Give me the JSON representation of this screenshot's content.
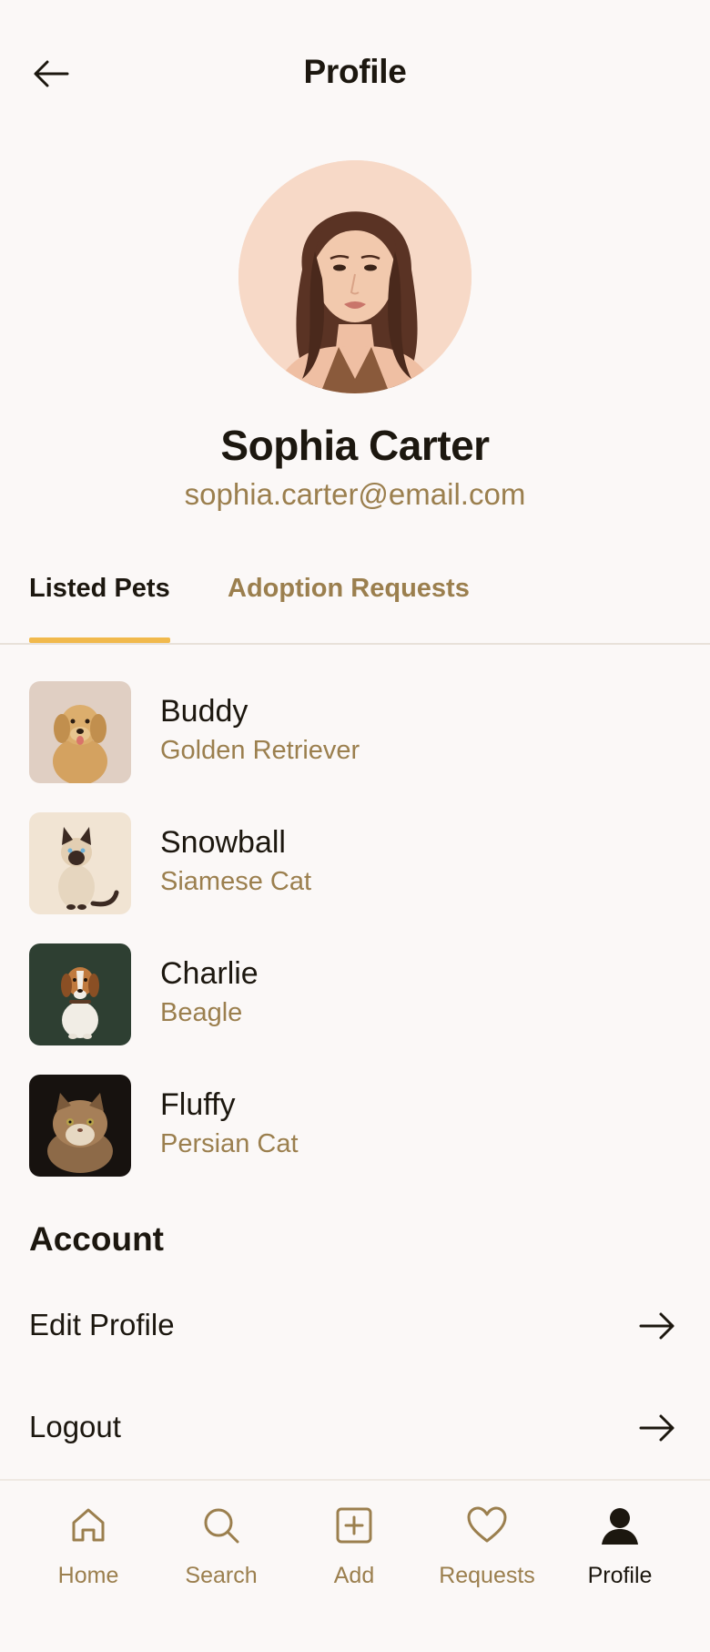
{
  "header": {
    "title": "Profile"
  },
  "user": {
    "name": "Sophia Carter",
    "email": "sophia.carter@email.com"
  },
  "tabs": [
    {
      "label": "Listed Pets",
      "active": true
    },
    {
      "label": "Adoption Requests",
      "active": false
    }
  ],
  "pets": [
    {
      "name": "Buddy",
      "breed": "Golden Retriever"
    },
    {
      "name": "Snowball",
      "breed": "Siamese Cat"
    },
    {
      "name": "Charlie",
      "breed": "Beagle"
    },
    {
      "name": "Fluffy",
      "breed": "Persian Cat"
    }
  ],
  "account": {
    "title": "Account",
    "items": [
      {
        "label": "Edit Profile",
        "icon": "arrow-right-icon"
      },
      {
        "label": "Logout",
        "icon": "arrow-right-icon"
      }
    ]
  },
  "nav": [
    {
      "label": "Home",
      "icon": "home-icon"
    },
    {
      "label": "Search",
      "icon": "search-icon"
    },
    {
      "label": "Add",
      "icon": "add-icon"
    },
    {
      "label": "Requests",
      "icon": "heart-icon"
    },
    {
      "label": "Profile",
      "icon": "profile-icon",
      "active": true
    }
  ],
  "colors": {
    "background": "#fbf8f7",
    "text": "#1c170f",
    "accent_text": "#9b7f4e",
    "tab_indicator": "#f1b94c"
  }
}
